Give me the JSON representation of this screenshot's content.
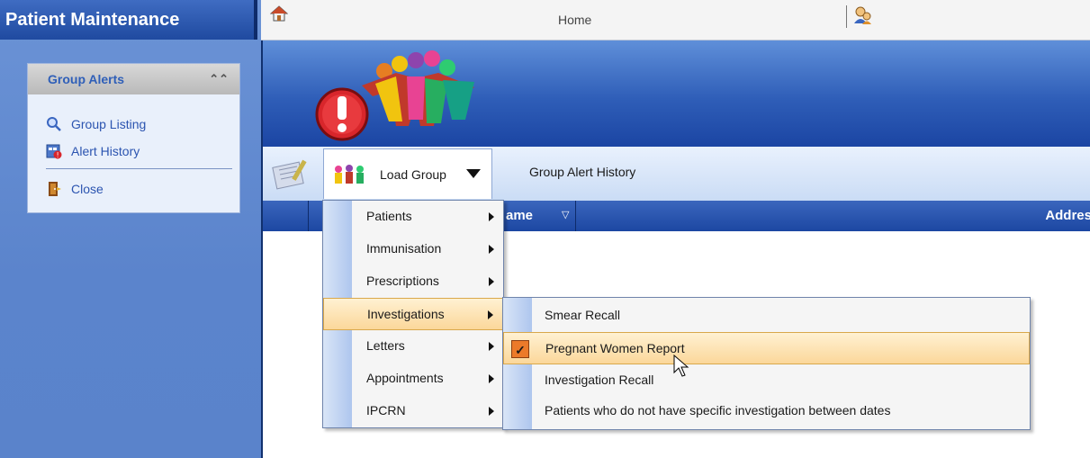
{
  "sidebar": {
    "title": "Patient Maintenance",
    "section_title": "Group Alerts",
    "collapse_icon": "double-chevron-up-icon",
    "links": [
      {
        "label": "Group Listing",
        "icon": "magnifier-icon"
      },
      {
        "label": "Alert History",
        "icon": "alert-history-icon"
      },
      {
        "label": "Close",
        "icon": "door-exit-icon"
      }
    ]
  },
  "topbar": {
    "home_label": "Home",
    "home_icon": "home-icon",
    "user_icon": "user-icon"
  },
  "toolbar": {
    "load_group_label": "Load Group",
    "group_alert_history_label": "Group Alert History"
  },
  "grid": {
    "columns": [
      "ame",
      "Addres"
    ]
  },
  "load_group_menu": [
    {
      "label": "Patients",
      "has_submenu": true
    },
    {
      "label": "Immunisation",
      "has_submenu": true
    },
    {
      "label": "Prescriptions",
      "has_submenu": true
    },
    {
      "label": "Investigations",
      "has_submenu": true,
      "highlighted": true
    },
    {
      "label": "Letters",
      "has_submenu": true
    },
    {
      "label": "Appointments",
      "has_submenu": true
    },
    {
      "label": "IPCRN",
      "has_submenu": true
    }
  ],
  "investigations_submenu": [
    {
      "label": "Smear Recall"
    },
    {
      "label": "Pregnant Women Report",
      "checked": true,
      "highlighted": true
    },
    {
      "label": "Investigation Recall"
    },
    {
      "label": "Patients who do not have specific investigation between dates"
    }
  ],
  "colors": {
    "banner_dark": "#1b45a3",
    "highlight": "#fbd79a",
    "check": "#ec7a2a"
  }
}
